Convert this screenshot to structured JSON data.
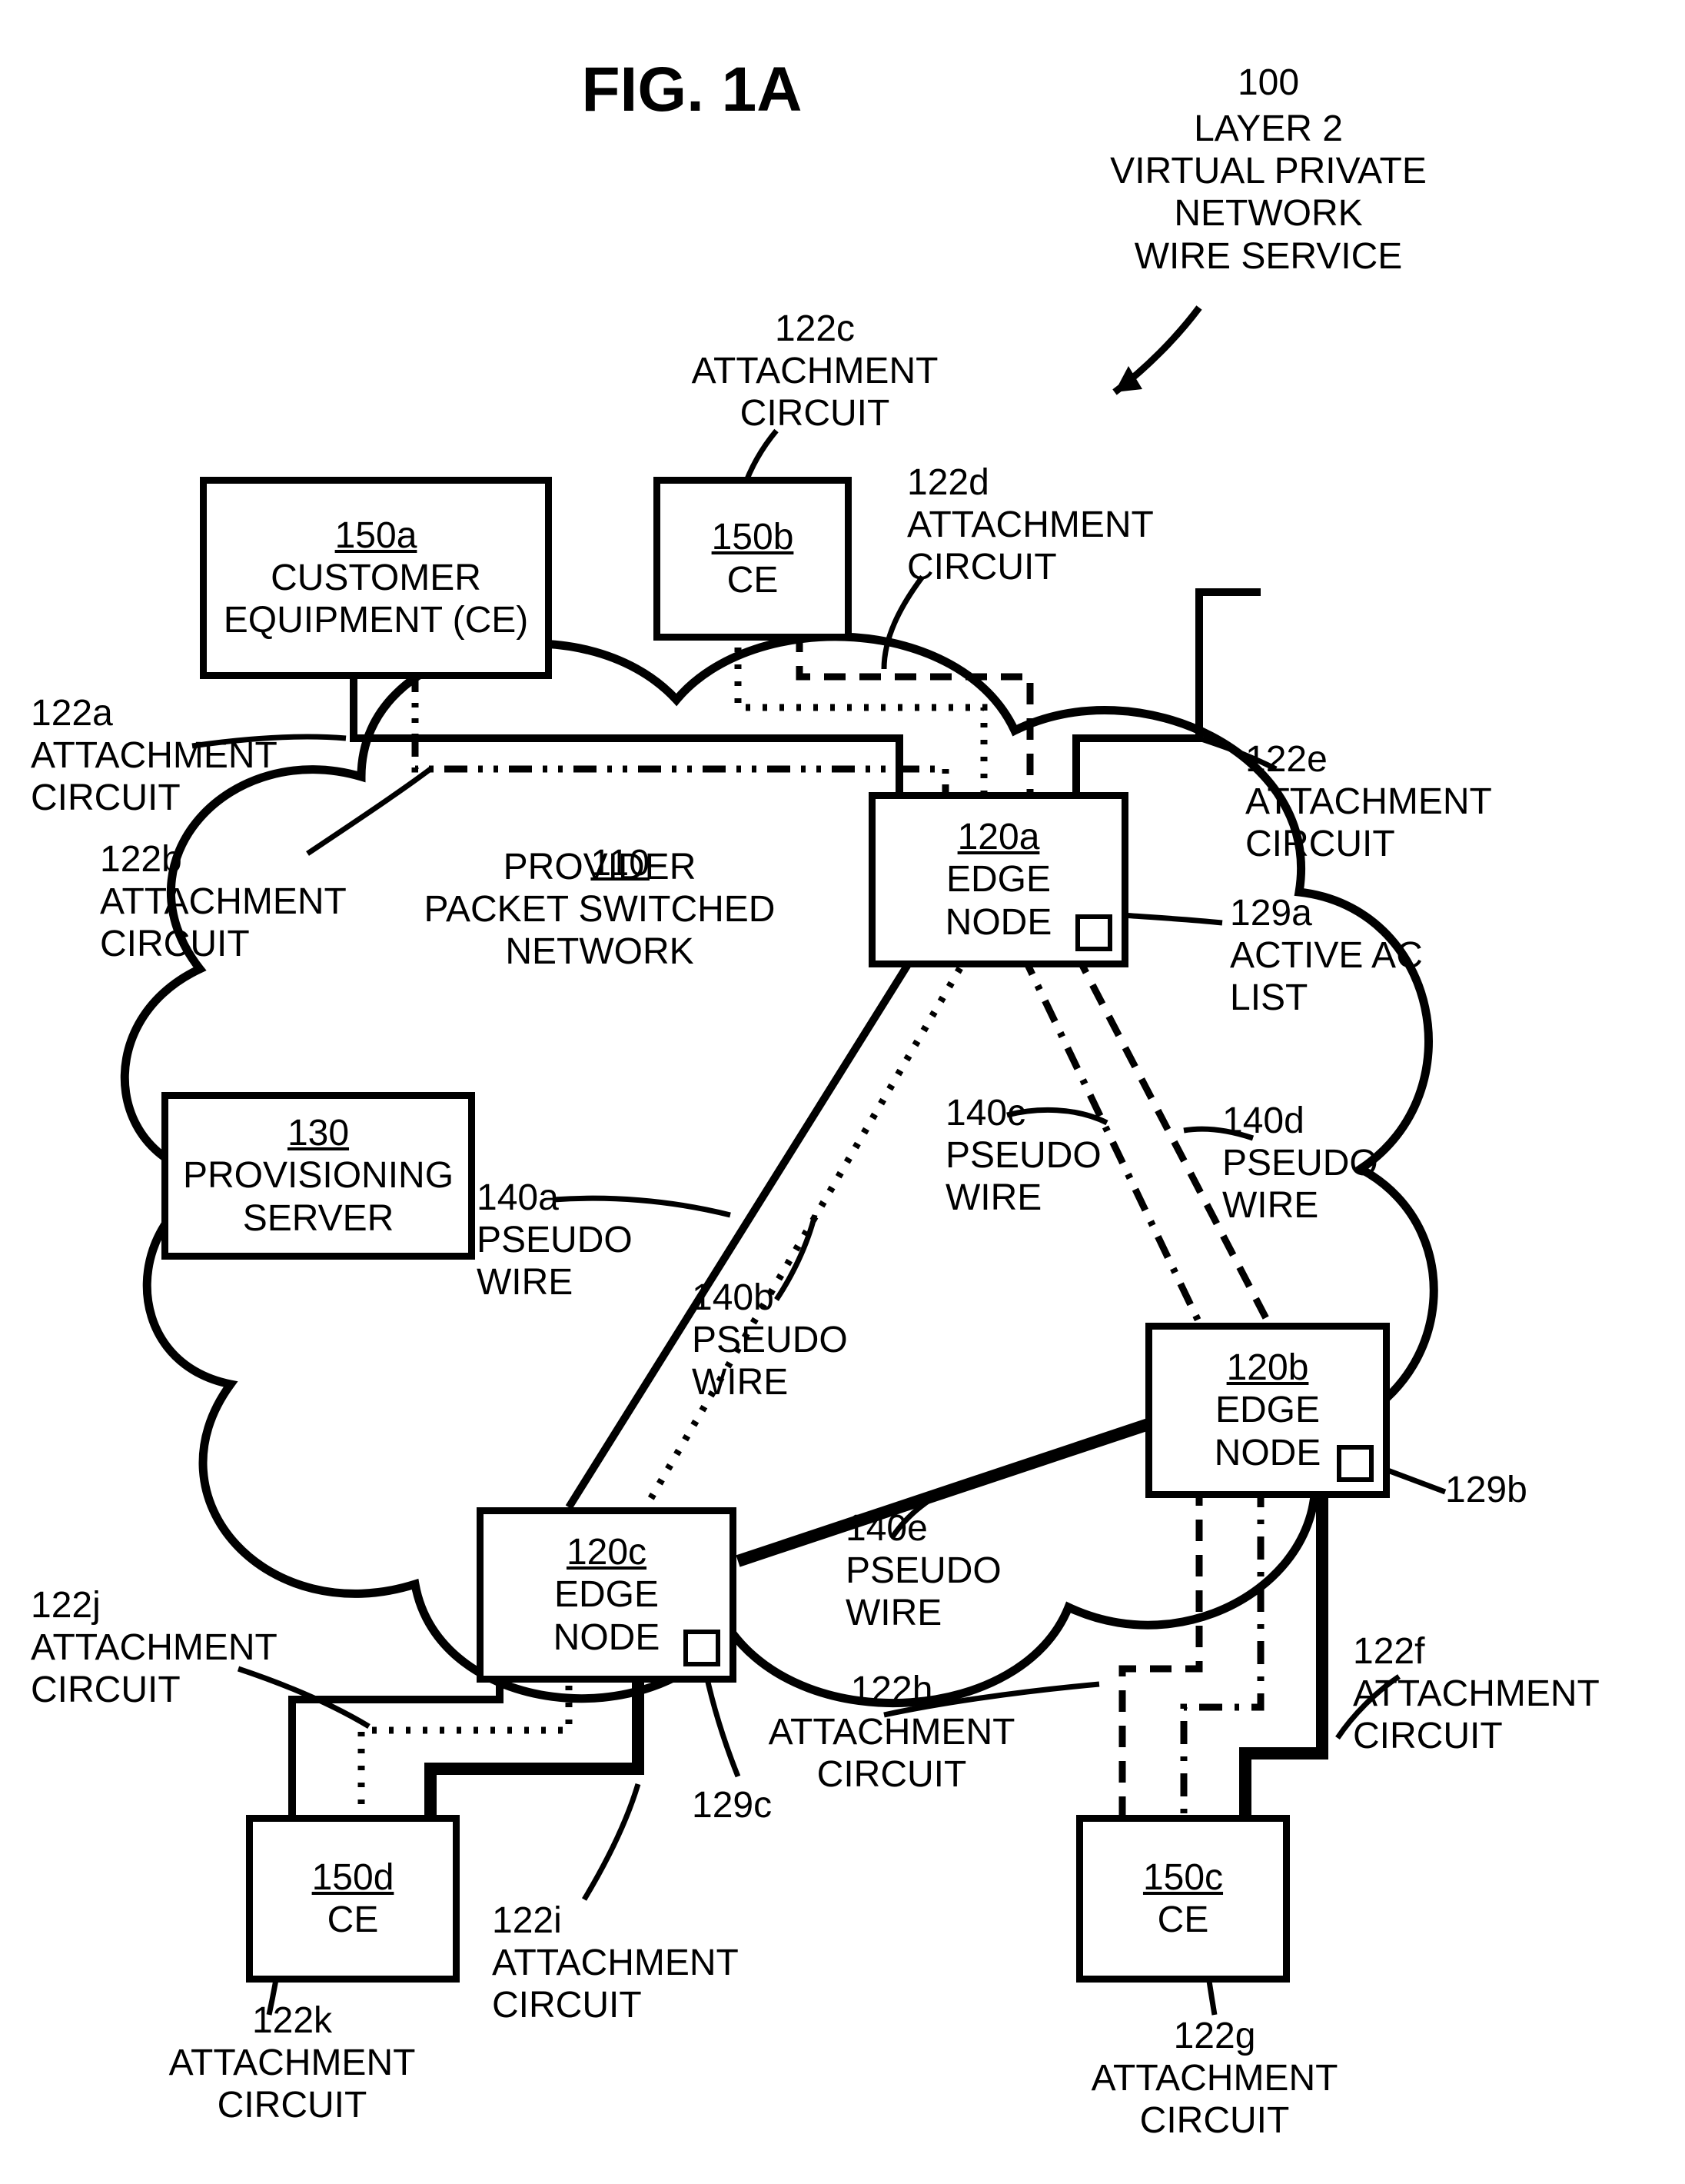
{
  "figure": {
    "title": "FIG. 1A",
    "overall_id": "100",
    "overall_label": "LAYER 2\nVIRTUAL PRIVATE\nNETWORK\nWIRE SERVICE"
  },
  "cloud": {
    "id": "110",
    "label": "PROVIDER\nPACKET SWITCHED\nNETWORK"
  },
  "nodes": {
    "ce_a": {
      "id": "150a",
      "label": "CUSTOMER\nEQUIPMENT (CE)"
    },
    "ce_b": {
      "id": "150b",
      "label": "CE"
    },
    "ce_c": {
      "id": "150c",
      "label": "CE"
    },
    "ce_d": {
      "id": "150d",
      "label": "CE"
    },
    "edge_a": {
      "id": "120a",
      "label": "EDGE\nNODE"
    },
    "edge_b": {
      "id": "120b",
      "label": "EDGE\nNODE"
    },
    "edge_c": {
      "id": "120c",
      "label": "EDGE\nNODE"
    },
    "prov": {
      "id": "130",
      "label": "PROVISIONING\nSERVER"
    }
  },
  "aclist": {
    "a129a": {
      "id": "129a",
      "label": "ACTIVE AC\nLIST"
    },
    "a129b": {
      "id": "129b"
    },
    "a129c": {
      "id": "129c"
    }
  },
  "attachments": {
    "a122a": {
      "id": "122a",
      "label": "ATTACHMENT\nCIRCUIT"
    },
    "a122b": {
      "id": "122b",
      "label": "ATTACHMENT\nCIRCUIT"
    },
    "a122c": {
      "id": "122c",
      "label": "ATTACHMENT\nCIRCUIT"
    },
    "a122d": {
      "id": "122d",
      "label": "ATTACHMENT\nCIRCUIT"
    },
    "a122e": {
      "id": "122e",
      "label": "ATTACHMENT\nCIRCUIT"
    },
    "a122f": {
      "id": "122f",
      "label": "ATTACHMENT\nCIRCUIT"
    },
    "a122g": {
      "id": "122g",
      "label": "ATTACHMENT\nCIRCUIT"
    },
    "a122h": {
      "id": "122h",
      "label": "ATTACHMENT\nCIRCUIT"
    },
    "a122i": {
      "id": "122i",
      "label": "ATTACHMENT\nCIRCUIT"
    },
    "a122j": {
      "id": "122j",
      "label": "ATTACHMENT\nCIRCUIT"
    },
    "a122k": {
      "id": "122k",
      "label": "ATTACHMENT\nCIRCUIT"
    }
  },
  "pseudo_wires": {
    "p140a": {
      "id": "140a",
      "label": "PSEUDO\nWIRE"
    },
    "p140b": {
      "id": "140b",
      "label": "PSEUDO\nWIRE"
    },
    "p140c": {
      "id": "140c",
      "label": "PSEUDO\nWIRE"
    },
    "p140d": {
      "id": "140d",
      "label": "PSEUDO\nWIRE"
    },
    "p140e": {
      "id": "140e",
      "label": "PSEUDO\nWIRE"
    }
  }
}
